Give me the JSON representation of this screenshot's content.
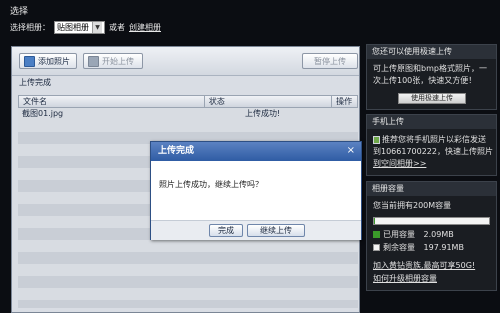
{
  "header": {
    "title": "选择",
    "album_label": "选择相册：",
    "album_selected": "贴图相册",
    "or_text": "或者",
    "create_album_link": "创建相册"
  },
  "toolbar": {
    "add_photo": "添加照片",
    "start_upload": "开始上传",
    "pause_upload": "暂停上传"
  },
  "upload_status": "上传完成",
  "table": {
    "columns": [
      "文件名",
      "状态",
      "操作"
    ],
    "rows": [
      {
        "filename": "截图01.jpg",
        "status": "上传成功!",
        "action": ""
      }
    ]
  },
  "dialog": {
    "title": "上传完成",
    "close": "×",
    "message": "照片上传成功，继续上传吗？",
    "done_button": "完成",
    "continue_button": "继续上传"
  },
  "sidebar": {
    "fast_upload": {
      "heading": "您还可以使用极速上传",
      "lines": [
        "可上传原图和bmp格式照片，一",
        "次上传100张，快速又方便！"
      ],
      "button": "使用极速上传"
    },
    "mobile_upload": {
      "heading": "手机上传",
      "lines": [
        "推荐您将手机照片以彩信发送",
        "到10661700222，快速上传照片",
        "到空间相册>>"
      ]
    },
    "capacity": {
      "heading": "相册容量",
      "total_text": "您当前拥有200M容量",
      "used_fraction": 0.01,
      "used_label": "已用容量",
      "used_value": "2.09MB",
      "free_label": "剩余容量",
      "free_value": "197.91MB",
      "upgrade_link": "加入黄钻贵族,最高可享50G!",
      "upgrade_capacity_link": "如何升级相册容量",
      "used_color": "#3a9a2a",
      "free_color": "#f4f4f4"
    }
  }
}
